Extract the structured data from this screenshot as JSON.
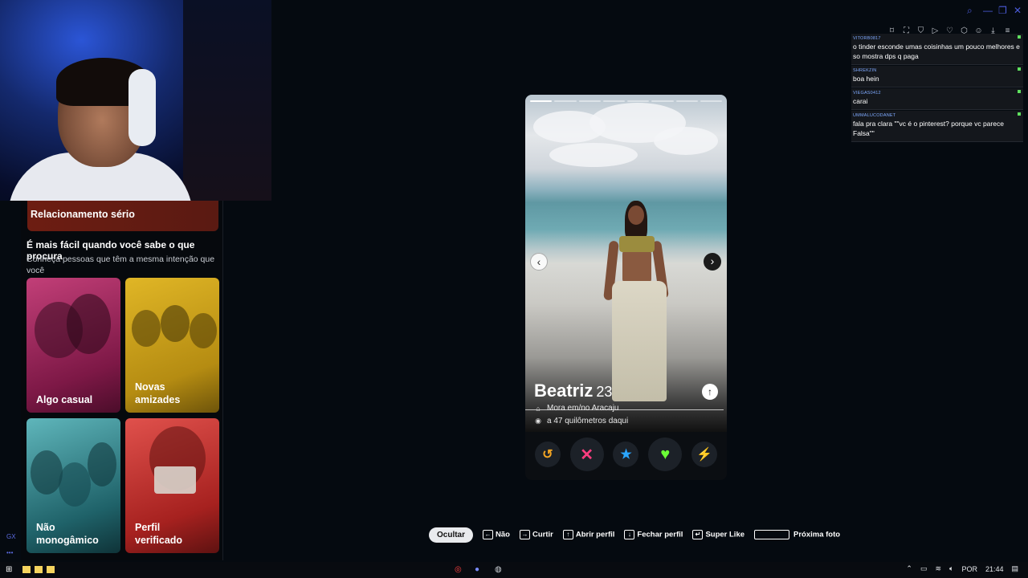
{
  "left_panel": {
    "intent_banner": "Relacionamento sério",
    "section_title": "É mais fácil quando você sabe o que procura",
    "section_subtitle": "Conheça pessoas que têm a mesma intenção que você",
    "cards": [
      {
        "label": "Algo casual",
        "color": "#c23f78"
      },
      {
        "label": "Novas amizades",
        "color": "#e0b626"
      },
      {
        "label": "Não monogâmico",
        "color": "#5fb6bb"
      },
      {
        "label": "Perfil verificado",
        "color": "#e0514c"
      }
    ]
  },
  "chat": {
    "messages": [
      {
        "user": "vitorb0817",
        "text": "o tinder esconde umas coisinhas um pouco melhores e so mostra dps q paga"
      },
      {
        "user": "shrekzin",
        "text": "boa hein"
      },
      {
        "user": "viegas0412",
        "text": "carai"
      },
      {
        "user": "ummalucodanet",
        "text": "fala pra clara \"\"vc é o pinterest? porque vc parece Falsa\"\""
      }
    ]
  },
  "profile": {
    "name": "Beatriz",
    "age": "23",
    "lives_in": "Mora em/no Aracaju",
    "distance": "a 47 quilômetros daqui",
    "photo_count": 8,
    "current_photo": 1,
    "prev_icon": "chevron-left-icon",
    "next_icon": "chevron-right-icon",
    "actions": [
      {
        "name": "rewind",
        "glyph": "↺",
        "color": "#f5a623"
      },
      {
        "name": "nope",
        "glyph": "✕",
        "color": "#ff3d7f"
      },
      {
        "name": "super-like",
        "glyph": "★",
        "color": "#2aa6ff"
      },
      {
        "name": "like",
        "glyph": "♥",
        "color": "#6bff36"
      },
      {
        "name": "boost",
        "glyph": "⚡",
        "color": "#b44dff"
      }
    ]
  },
  "shortcuts": {
    "hide": "Ocultar",
    "items": [
      {
        "key": "←",
        "label": "Não"
      },
      {
        "key": "→",
        "label": "Curtir"
      },
      {
        "key": "↑",
        "label": "Abrir perfil"
      },
      {
        "key": "↓",
        "label": "Fechar perfil"
      },
      {
        "key": "↵",
        "label": "Super Like"
      },
      {
        "key": "space",
        "label": "Próxima foto"
      }
    ]
  },
  "bottom_left": {
    "gx": "GX",
    "more": "•••"
  },
  "taskbar": {
    "language": "POR",
    "time": "21:44"
  }
}
